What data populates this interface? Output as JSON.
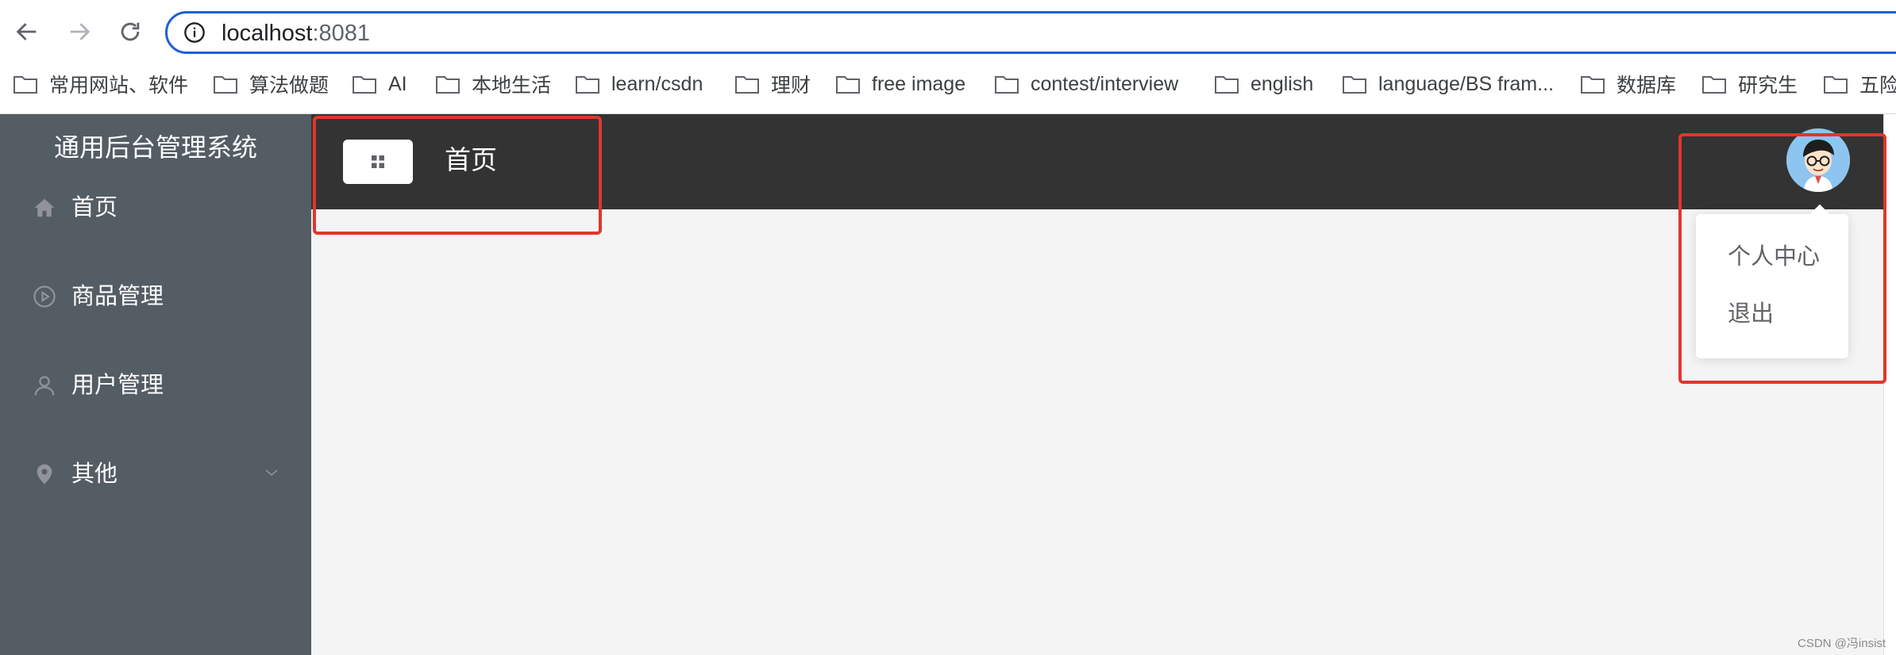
{
  "browser": {
    "url_host": "localhost",
    "url_port": ":8081",
    "bookmarks": [
      "常用网站、软件",
      "算法做题",
      "AI",
      "本地生活",
      "learn/csdn",
      "理财",
      "free image",
      "contest/interview",
      "english",
      "language/BS fram...",
      "数据库",
      "研究生",
      "五险"
    ]
  },
  "app": {
    "system_title": "通用后台管理系统",
    "menu": [
      {
        "label": "首页",
        "icon": "home-icon"
      },
      {
        "label": "商品管理",
        "icon": "video-play-icon"
      },
      {
        "label": "用户管理",
        "icon": "user-icon"
      },
      {
        "label": "其他",
        "icon": "location-icon"
      }
    ],
    "header": {
      "breadcrumb": "首页"
    },
    "user_dropdown": {
      "items": [
        "个人中心",
        "退出"
      ]
    }
  },
  "watermark": "CSDN @冯insist",
  "colors": {
    "sidebar_bg": "#545c64",
    "header_bg": "#333333",
    "main_bg": "#f4f4f4",
    "highlight_box": "#e0362c",
    "url_focus": "#1f5fd1"
  }
}
